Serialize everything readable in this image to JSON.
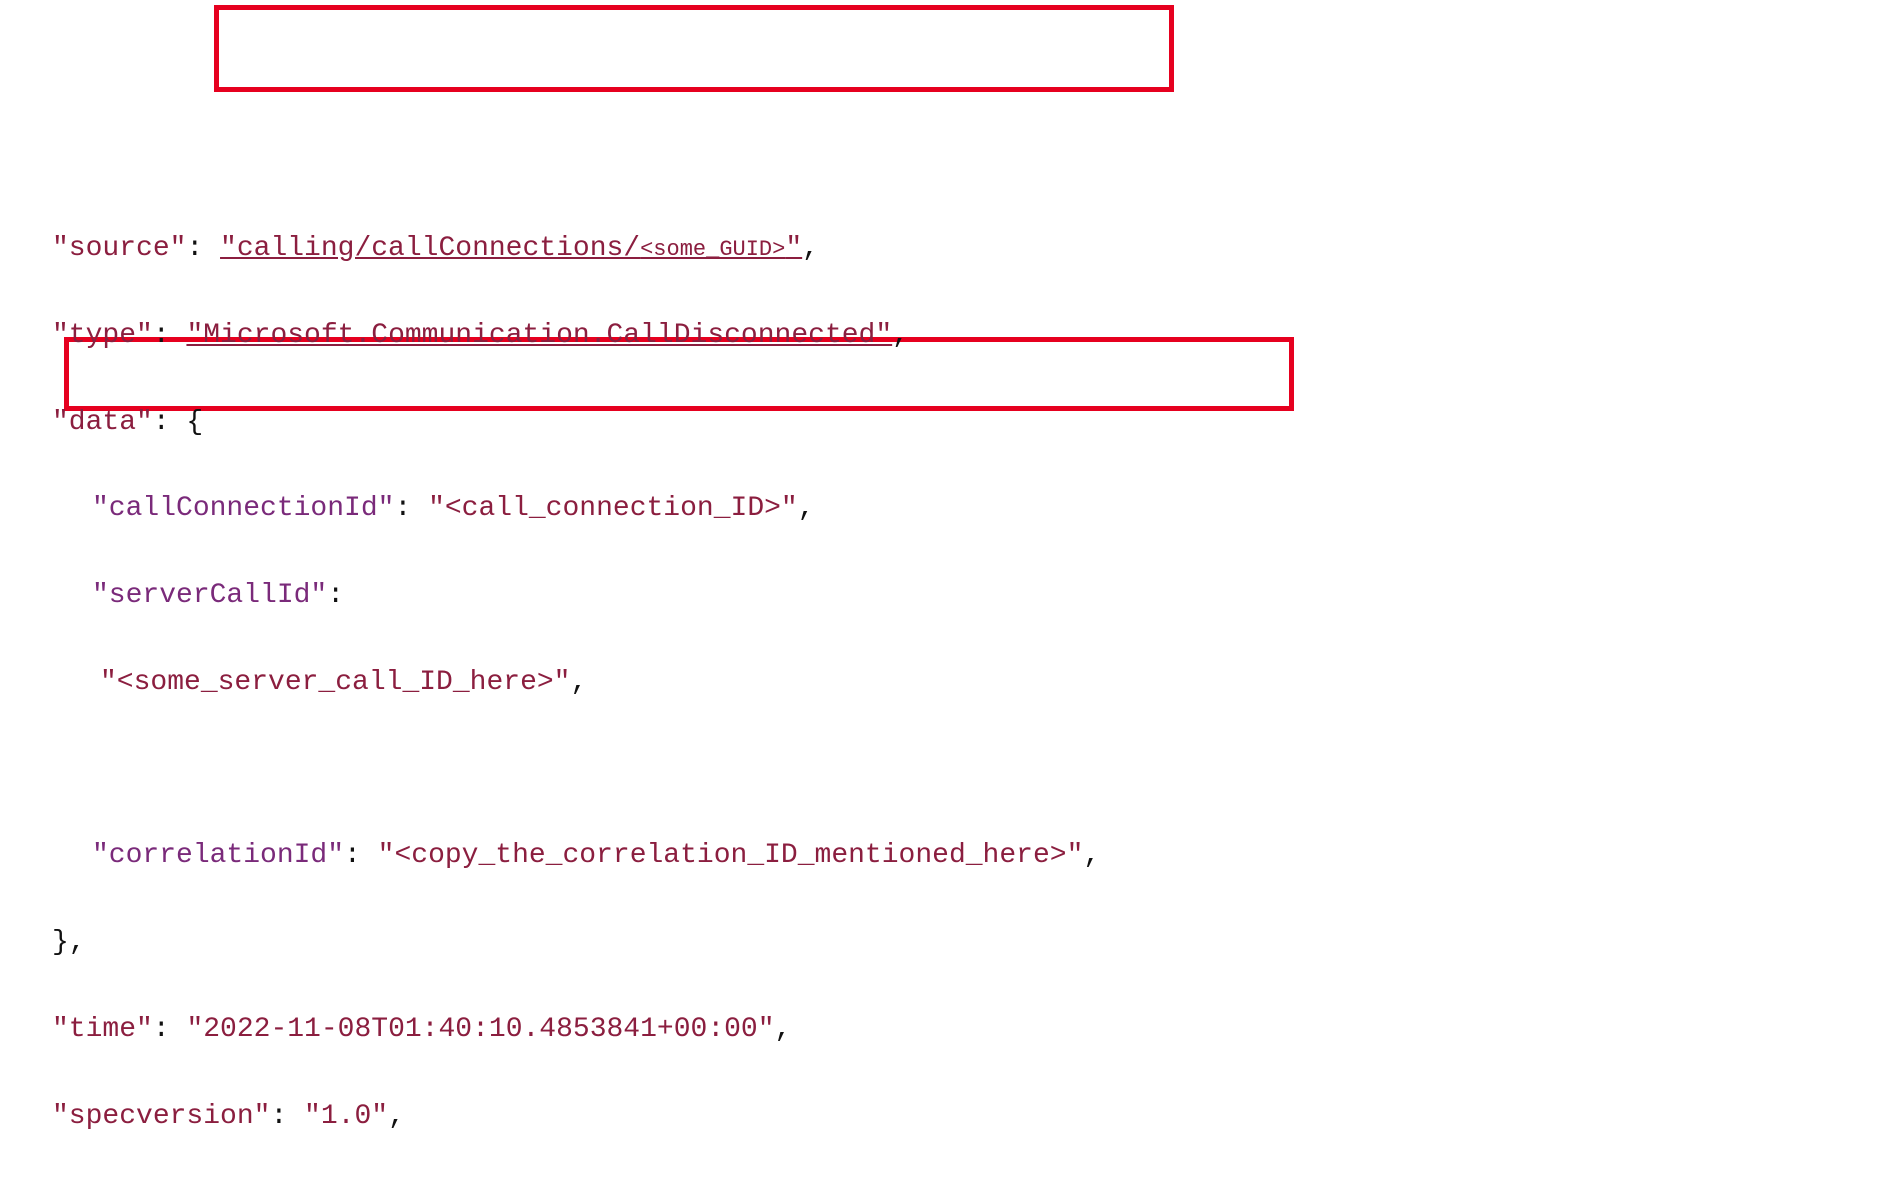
{
  "json": {
    "source_key": "\"source\"",
    "source_val_prefix": "\"calling/callConnections/",
    "source_val_guid": "<some_GUID>",
    "source_val_suffix": "\"",
    "type_key": "\"type\"",
    "type_val": "\"Microsoft.Communication.CallDisconnected\"",
    "data_key": "\"data\"",
    "cc_key": "\"callConnectionId\"",
    "cc_val": "\"<call_connection_ID>\"",
    "sc_key": "\"serverCallId\"",
    "sc_val": "\"<some_server_call_ID_here>\"",
    "corr_key": "\"correlationId\"",
    "corr_val": "\"<copy_the_correlation_ID_mentioned_here>\"",
    "time_key": "\"time\"",
    "time_val": "\"2022-11-08T01:40:10.4853841+00:00\"",
    "spec_key": "\"specversion\"",
    "spec_val": "\"1.0\""
  },
  "highlights": [
    {
      "target": "type value — Microsoft.Communication.CallDisconnected"
    },
    {
      "target": "correlationId line"
    }
  ]
}
